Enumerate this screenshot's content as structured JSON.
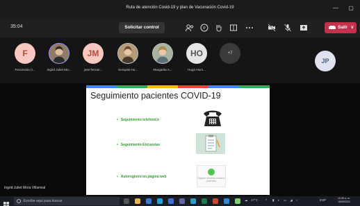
{
  "window": {
    "title": "Ruta de atención Covid-19 y plan de Vacunación Covid-19"
  },
  "meeting": {
    "timer": "35:04",
    "request_control_label": "Solicitar control",
    "leave_label": "Salir"
  },
  "participants": [
    {
      "initials": "F",
      "name": "Feconvida (I..."
    },
    {
      "initials": "",
      "name": "Ingrid Juliet Mo..."
    },
    {
      "initials": "JM",
      "name": "jose fernan..."
    },
    {
      "initials": "",
      "name": "Sorayda Hu..."
    },
    {
      "initials": "",
      "name": "Margarita A..."
    },
    {
      "initials": "HO",
      "name": "Hugo Hum..."
    },
    {
      "initials": "+7",
      "name": ""
    }
  ],
  "self_avatar": {
    "initials": "JP"
  },
  "slide": {
    "title": "Seguimiento pacientes COVID-19",
    "items": [
      "Seguimiento telefónico",
      "Seguimiento Encuestas",
      "Autoregistro en página web"
    ],
    "web_card_text": "Registro síntomas cuidados pacientes",
    "bar_colors": [
      "#4285f4",
      "#34a853",
      "#fbbc05",
      "#ea4335",
      "#4285f4",
      "#34a853"
    ]
  },
  "speaker_label": "Ingrid Juliet Mora Villarreal",
  "taskbar": {
    "search_placeholder": "Escribe aquí para buscar",
    "weather": "17°C",
    "language": "ESP",
    "time": "10:35 a. m.",
    "date": "16/09/2021"
  },
  "colors": {
    "leave": "#c4314b",
    "accent": "#6264a7"
  }
}
